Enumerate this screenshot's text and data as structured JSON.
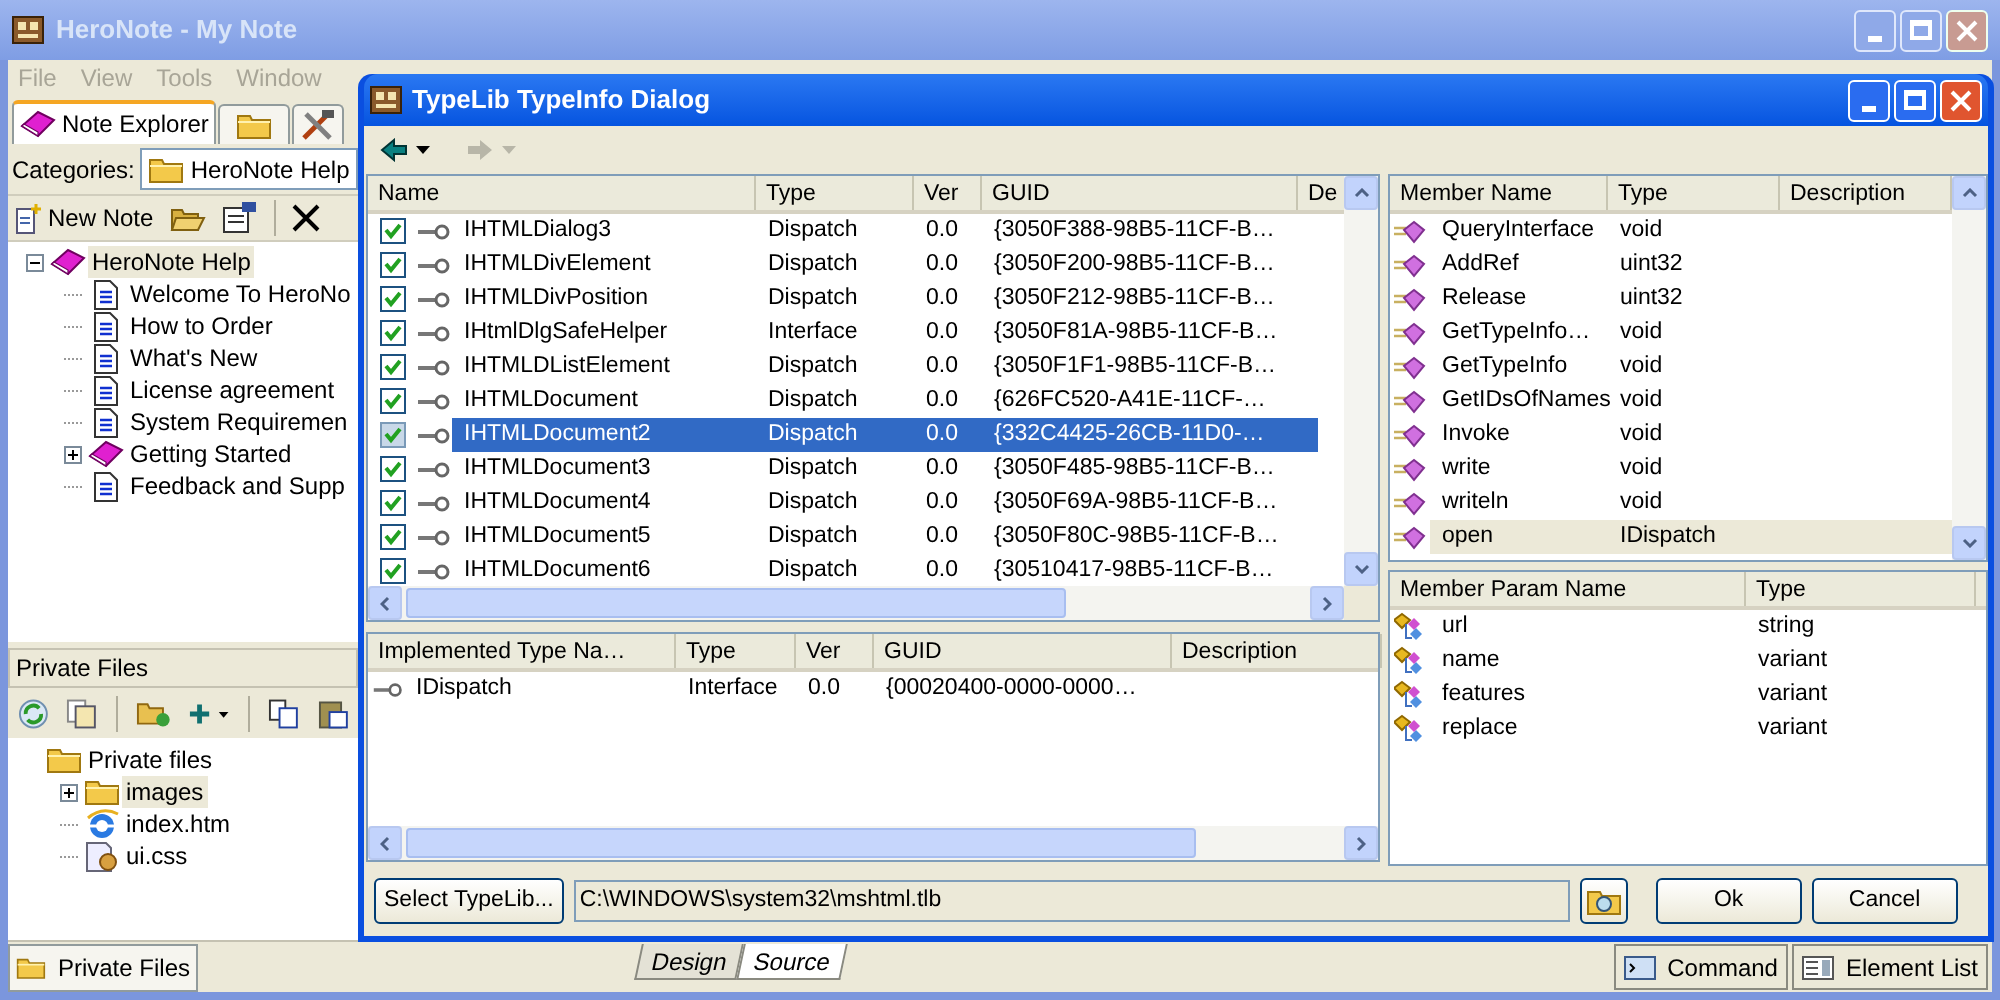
{
  "main_window": {
    "title": "HeroNote - My Note"
  },
  "menu": [
    "File",
    "View",
    "Tools",
    "Window"
  ],
  "explorer": {
    "tabs": [
      {
        "label": "Note Explorer",
        "selected": true
      },
      {
        "selected": false
      },
      {
        "selected": false
      }
    ],
    "categories_label": "Categories:",
    "category": "HeroNote Help",
    "new_note": "New Note",
    "tree": [
      {
        "label": "HeroNote Help",
        "kind": "book",
        "expanded": true,
        "selected": true,
        "children": [
          {
            "label": "Welcome To HeroNo",
            "kind": "page",
            "selected": false
          },
          {
            "label": "How to Order",
            "kind": "page",
            "selected": false
          },
          {
            "label": "What's New",
            "kind": "page",
            "selected": false
          },
          {
            "label": "License agreement",
            "kind": "page",
            "selected": false
          },
          {
            "label": "System Requiremen",
            "kind": "page",
            "selected": false
          },
          {
            "label": "Getting Started",
            "kind": "book",
            "expanded": false,
            "selected": false
          },
          {
            "label": "Feedback and Supp",
            "kind": "page",
            "selected": false
          }
        ]
      }
    ]
  },
  "private_files": {
    "title": "Private Files",
    "tree": [
      {
        "label": "Private files",
        "kind": "folder",
        "selected": false,
        "children": [
          {
            "label": "images",
            "kind": "folder",
            "expanded": false,
            "selected": true
          },
          {
            "label": "index.htm",
            "kind": "html",
            "selected": false
          },
          {
            "label": "ui.css",
            "kind": "css",
            "selected": false
          }
        ]
      }
    ]
  },
  "bottom_bar": {
    "panel_tab": "Private Files",
    "view_tabs": [
      {
        "label": "Design",
        "selected": false
      },
      {
        "label": "Source",
        "selected": true
      }
    ],
    "panels": [
      "Command",
      "Element List"
    ]
  },
  "dialog": {
    "title": "TypeLib TypeInfo Dialog",
    "types": {
      "columns": [
        "Name",
        "Type",
        "Ver",
        "GUID",
        "De"
      ],
      "rows": [
        {
          "checked": true,
          "selected": false,
          "name": "IHTMLDialog3",
          "type": "Dispatch",
          "ver": "0.0",
          "guid": "{3050F388-98B5-11CF-B…"
        },
        {
          "checked": true,
          "selected": false,
          "name": "IHTMLDivElement",
          "type": "Dispatch",
          "ver": "0.0",
          "guid": "{3050F200-98B5-11CF-B…"
        },
        {
          "checked": true,
          "selected": false,
          "name": "IHTMLDivPosition",
          "type": "Dispatch",
          "ver": "0.0",
          "guid": "{3050F212-98B5-11CF-B…"
        },
        {
          "checked": true,
          "selected": false,
          "name": "IHtmlDlgSafeHelper",
          "type": "Interface",
          "ver": "0.0",
          "guid": "{3050F81A-98B5-11CF-B…"
        },
        {
          "checked": true,
          "selected": false,
          "name": "IHTMLDListElement",
          "type": "Dispatch",
          "ver": "0.0",
          "guid": "{3050F1F1-98B5-11CF-B…"
        },
        {
          "checked": true,
          "selected": false,
          "name": "IHTMLDocument",
          "type": "Dispatch",
          "ver": "0.0",
          "guid": "{626FC520-A41E-11CF-…"
        },
        {
          "checked": true,
          "selected": true,
          "name": "IHTMLDocument2",
          "type": "Dispatch",
          "ver": "0.0",
          "guid": "{332C4425-26CB-11D0-…"
        },
        {
          "checked": true,
          "selected": false,
          "name": "IHTMLDocument3",
          "type": "Dispatch",
          "ver": "0.0",
          "guid": "{3050F485-98B5-11CF-B…"
        },
        {
          "checked": true,
          "selected": false,
          "name": "IHTMLDocument4",
          "type": "Dispatch",
          "ver": "0.0",
          "guid": "{3050F69A-98B5-11CF-B…"
        },
        {
          "checked": true,
          "selected": false,
          "name": "IHTMLDocument5",
          "type": "Dispatch",
          "ver": "0.0",
          "guid": "{3050F80C-98B5-11CF-B…"
        },
        {
          "checked": true,
          "selected": false,
          "name": "IHTMLDocument6",
          "type": "Dispatch",
          "ver": "0.0",
          "guid": "{30510417-98B5-11CF-B…"
        }
      ]
    },
    "implemented": {
      "columns": [
        "Implemented Type Na…",
        "Type",
        "Ver",
        "GUID",
        "Description"
      ],
      "rows": [
        {
          "name": "IDispatch",
          "type": "Interface",
          "ver": "0.0",
          "guid": "{00020400-0000-0000…"
        }
      ]
    },
    "members": {
      "columns": [
        "Member Name",
        "Type",
        "Description"
      ],
      "rows": [
        {
          "name": "QueryInterface",
          "type": "void",
          "selected": false
        },
        {
          "name": "AddRef",
          "type": "uint32",
          "selected": false
        },
        {
          "name": "Release",
          "type": "uint32",
          "selected": false
        },
        {
          "name": "GetTypeInfo…",
          "type": "void",
          "selected": false
        },
        {
          "name": "GetTypeInfo",
          "type": "void",
          "selected": false
        },
        {
          "name": "GetIDsOfNames",
          "type": "void",
          "selected": false
        },
        {
          "name": "Invoke",
          "type": "void",
          "selected": false
        },
        {
          "name": "write",
          "type": "void",
          "selected": false
        },
        {
          "name": "writeln",
          "type": "void",
          "selected": false
        },
        {
          "name": "open",
          "type": "IDispatch",
          "selected": true
        }
      ]
    },
    "params": {
      "columns": [
        "Member Param Name",
        "Type"
      ],
      "rows": [
        {
          "name": "url",
          "type": "string"
        },
        {
          "name": "name",
          "type": "variant"
        },
        {
          "name": "features",
          "type": "variant"
        },
        {
          "name": "replace",
          "type": "variant"
        }
      ]
    },
    "select_button": "Select TypeLib...",
    "path": "C:\\WINDOWS\\system32\\mshtml.tlb",
    "buttons": [
      "Ok",
      "Cancel"
    ]
  }
}
